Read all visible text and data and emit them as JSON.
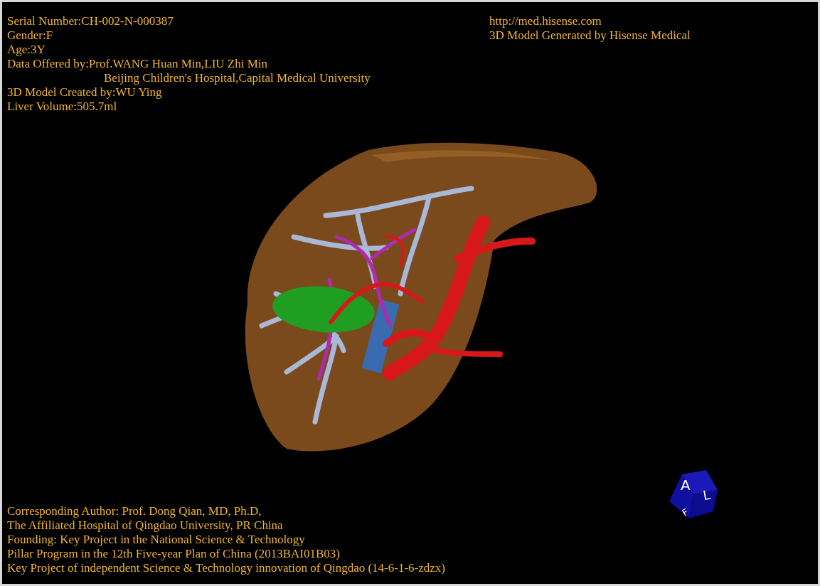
{
  "patient_info": [
    {
      "text": "Serial Number:CH-002-N-000387",
      "indented": false
    },
    {
      "text": "Gender:F",
      "indented": false
    },
    {
      "text": "Age:3Y",
      "indented": false
    },
    {
      "text": "Data Offered by:Prof.WANG Huan Min,LIU Zhi Min",
      "indented": false
    },
    {
      "text": "Beijing Children's Hospital,Capital Medical University",
      "indented": true
    },
    {
      "text": "3D Model Created by:WU Ying",
      "indented": false
    },
    {
      "text": "Liver Volume:505.7ml",
      "indented": false
    }
  ],
  "generator_info": {
    "url": "http://med.hisense.com",
    "credit": "3D Model Generated by Hisense Medical"
  },
  "orientation_cube": {
    "front": "A",
    "side": "L",
    "bottom": "F"
  },
  "credits": [
    "Corresponding Author: Prof. Dong Qian, MD, Ph.D,",
    "The Affiliated Hospital of Qingdao University, PR China",
    "Founding: Key Project in the National Science & Technology",
    "Pillar Program in the 12th Five-year Plan of China (2013BAI01B03)",
    "Key Project of independent Science & Technology innovation of Qingdao (14-6-1-6-zdzx)"
  ]
}
